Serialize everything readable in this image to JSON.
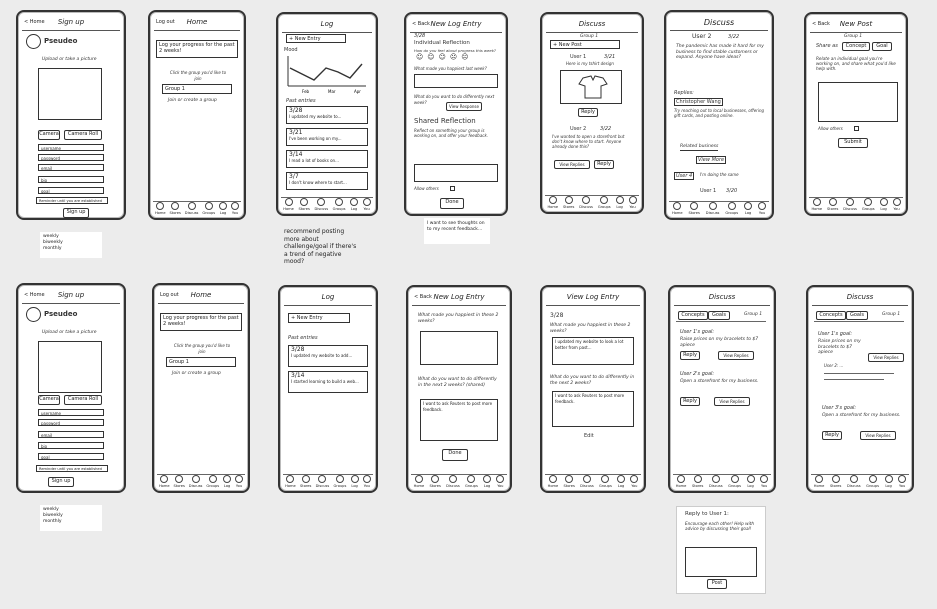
{
  "nav_labels": [
    "Home",
    "Stores",
    "Discuss",
    "Groups",
    "Log",
    "You"
  ],
  "signup": {
    "back": "< Home",
    "title": "Sign up",
    "name": "Pseudeo",
    "photo_hint": "Upload or take a picture",
    "camera": "Camera",
    "camera_roll": "Camera Roll",
    "fields": [
      "username",
      "password",
      "email",
      "bio",
      "goal"
    ],
    "reminder": "Reminder until you are established",
    "submit": "Sign up"
  },
  "signup_note": "weekly\nbiweekly\nmonthly",
  "home": {
    "logout": "Log out",
    "title": "Home",
    "progress": "Log your progress for the past 2 weeks!",
    "goal_hint": "Click the group you'd like to join",
    "group": "Group 1",
    "join": "Join or create a group"
  },
  "log": {
    "title": "Log",
    "new_entry": "+ New Entry",
    "mood": "Mood",
    "chart_months": [
      "Feb",
      "Mar",
      "Apr"
    ],
    "past_entries": "Past entries",
    "entries": [
      {
        "date": "3/28",
        "text": "I updated my website to..."
      },
      {
        "date": "3/21",
        "text": "I've been working on my..."
      },
      {
        "date": "3/14",
        "text": "I read a lot of books on..."
      },
      {
        "date": "3/7",
        "text": "I don't know where to start..."
      }
    ]
  },
  "log_note": "recommend posting more about challenge/goal if there's a trend of negative mood?",
  "new_log": {
    "back": "< Back",
    "title": "New Log Entry",
    "date": "3/28",
    "reflection": "Individual Reflection",
    "mood_q": "How do you feel about progress this week?",
    "happiest_q": "What made you happiest last week?",
    "next_q": "What do you want to do differently next week?",
    "view_response": "View Response",
    "shared": "Shared Reflection",
    "shared_q": "Reflect on something your group is working on, and offer your feedback.",
    "shared_sample": "I've wanted to open a storefront but don't know where to start. Anyone already done this?",
    "allow_others": "Allow others",
    "done": "Done"
  },
  "new_log_note": "I want to see thoughts on to my recent feedback...",
  "discuss": {
    "title": "Discuss",
    "group": "Group 1",
    "new_post": "+ New Post",
    "user1": "User 1",
    "user1_date": "3/21",
    "user1_text": "Here is my tshirt design",
    "reply": "Reply",
    "user2": "User 2",
    "user2_date": "3/22",
    "user2_text": "I've wanted to open a storefront but don't know where to start. Anyone already done this?",
    "view_replies": "View Replies"
  },
  "thread": {
    "title": "Discuss",
    "user": "User 2",
    "date": "3/22",
    "body": "The pandemic has made it hard for my business to find stable customers or expand. Anyone have ideas?",
    "replies": "Replies:",
    "reply1_user": "Christopher Wang",
    "reply1_text": "Try reaching out to local businesses, offering gift cards, and posting online.",
    "reply2": "Related business",
    "view_more": "View More",
    "reply3_user": "User 4",
    "reply3_text": "I'm doing the same",
    "user1": "User 1",
    "user1_date": "3/20"
  },
  "new_post": {
    "back": "< Back",
    "title": "New Post",
    "group": "Group 1",
    "share_as": "Share as",
    "concept": "Concept",
    "goal": "Goal",
    "prompt": "Relate an individual goal you're working on, and share what you'd like help with.",
    "allow_others": "Allow others",
    "submit": "Submit"
  },
  "row2_log": {
    "new_entry": "+ New Entry",
    "past_entries": "Past entries",
    "entries": [
      {
        "date": "3/28",
        "text": "I updated my website to add..."
      },
      {
        "date": "3/14",
        "text": "I started learning to build a web..."
      }
    ]
  },
  "row2_new_log": {
    "title": "New Log Entry",
    "q1": "What made you happiest in these 2 weeks?",
    "q2": "What do you want to do differently in the next 2 weeks? (shared)",
    "sample": "I want to ask Reuters to post more feedback.",
    "done": "Done"
  },
  "row2_view_log": {
    "title": "View Log Entry",
    "date": "3/28",
    "q1": "What made you happiest in these 2 weeks?",
    "a1": "I updated my website to look a lot better from past...",
    "q2": "What do you want to do differently in the next 2 weeks?",
    "a2": "I want to ask Reuters to post more feedback.",
    "edit": "Edit"
  },
  "row2_discuss": {
    "title": "Discuss",
    "tabs": [
      "Concepts",
      "Goals"
    ],
    "group": "Group 1",
    "post1_user": "User 1's goal:",
    "post1_text": "Raise prices on my bracelets to $7 apiece",
    "reply": "Reply",
    "view_replies": "View Replies",
    "post2_user": "User 2's goal:",
    "post2_text": "Open a storefront for my business."
  },
  "row2_discuss_b": {
    "title": "Discuss",
    "tabs": [
      "Concepts",
      "Goals"
    ],
    "group": "Group 1",
    "post1_user": "User 1's goal:",
    "post1_text": "Raise prices on my bracelets to $7 apiece",
    "view_replies": "View Replies",
    "sub1": "User 2: ...",
    "post3_user": "User 3's goal:",
    "post3_text": "Open a storefront for my business.",
    "reply": "Reply"
  },
  "reply_card": {
    "title": "Reply to User 1:",
    "prompt": "Encourage each other! Help with advice by discussing their goal!",
    "post": "Post"
  }
}
